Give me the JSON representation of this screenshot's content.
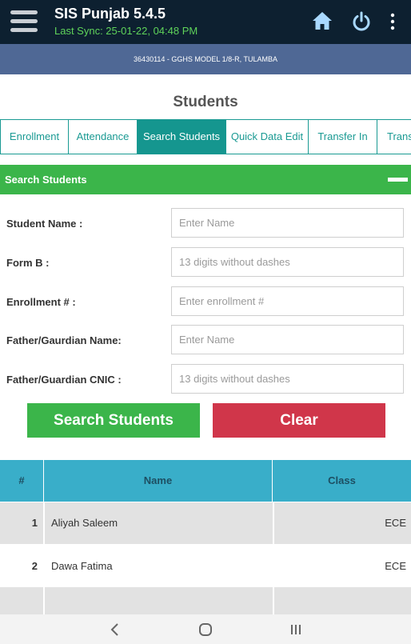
{
  "app": {
    "title": "SIS Punjab 5.4.5",
    "last_sync": "Last Sync: 25-01-22, 04:48 PM",
    "icons": [
      "menu-icon",
      "home-icon",
      "power-icon",
      "more-vert-icon"
    ]
  },
  "school": {
    "label": "36430114 - GGHS MODEL 1/8-R, TULAMBA"
  },
  "page": {
    "title": "Students"
  },
  "tabs": [
    {
      "label": "Enrollment",
      "active": false
    },
    {
      "label": "Attendance",
      "active": false
    },
    {
      "label": "Search Students",
      "active": true
    },
    {
      "label": "Quick Data Edit",
      "active": false
    },
    {
      "label": "Transfer In",
      "active": false
    },
    {
      "label": "Transfer Out",
      "active": false
    }
  ],
  "section": {
    "title": "Search Students"
  },
  "form": {
    "student_name": {
      "label": "Student Name :",
      "placeholder": "Enter Name",
      "value": ""
    },
    "form_b": {
      "label": "Form B :",
      "placeholder": "13 digits without dashes",
      "value": ""
    },
    "enrollment": {
      "label": "Enrollment # :",
      "placeholder": "Enter enrollment #",
      "value": ""
    },
    "father_name": {
      "label": "Father/Gaurdian Name:",
      "placeholder": "Enter Name",
      "value": ""
    },
    "father_cnic": {
      "label": "Father/Guardian CNIC :",
      "placeholder": "13 digits without dashes",
      "value": ""
    },
    "search_button": "Search Students",
    "clear_button": "Clear"
  },
  "table": {
    "headers": {
      "num": "#",
      "name": "Name",
      "class": "Class"
    },
    "rows": [
      {
        "num": "1",
        "name": "Aliyah Saleem",
        "class": "ECE"
      },
      {
        "num": "2",
        "name": "Dawa Fatima",
        "class": "ECE"
      }
    ]
  },
  "colors": {
    "appbar": "#0d2030",
    "sync_text": "#5fd35a",
    "school_bar": "#4f6895",
    "teal": "#15968f",
    "green": "#3bb54a",
    "red": "#d0364a",
    "table_header": "#39aec9"
  }
}
